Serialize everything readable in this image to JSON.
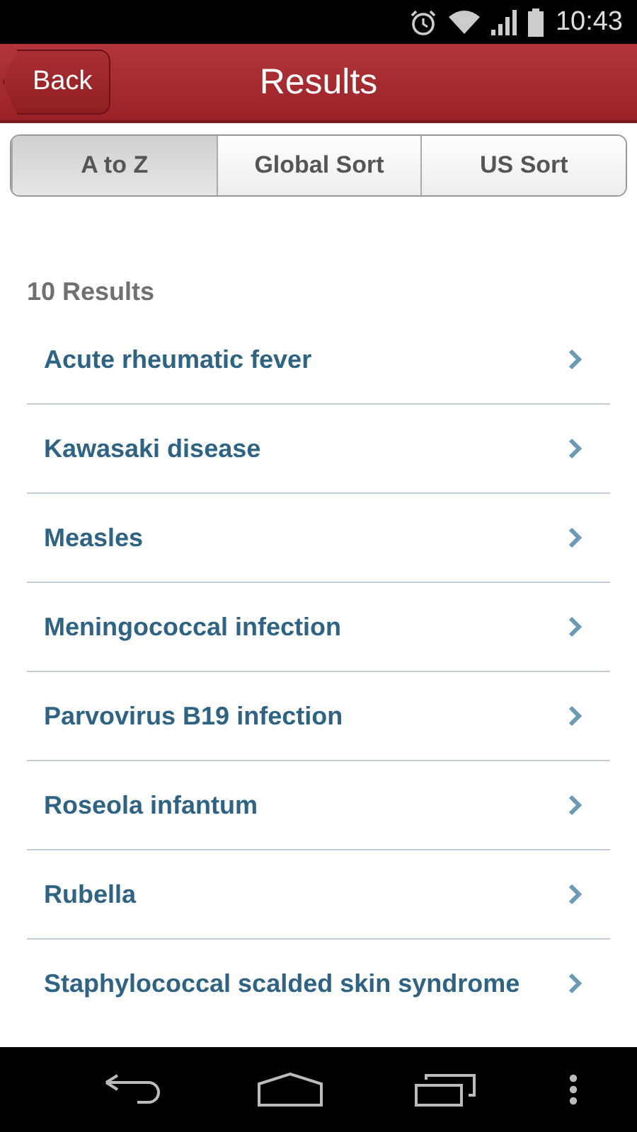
{
  "status_bar": {
    "time": "10:43"
  },
  "header": {
    "back": "Back",
    "title": "Results"
  },
  "tabs": [
    {
      "label": "A to Z",
      "selected": true
    },
    {
      "label": "Global Sort",
      "selected": false
    },
    {
      "label": "US Sort",
      "selected": false
    }
  ],
  "results": {
    "count": "10 Results",
    "items": [
      {
        "label": "Acute rheumatic fever"
      },
      {
        "label": "Kawasaki disease"
      },
      {
        "label": "Measles"
      },
      {
        "label": "Meningococcal infection"
      },
      {
        "label": "Parvovirus B19 infection"
      },
      {
        "label": "Roseola infantum"
      },
      {
        "label": "Rubella"
      },
      {
        "label": "Staphylococcal scalded skin syndrome"
      }
    ]
  }
}
